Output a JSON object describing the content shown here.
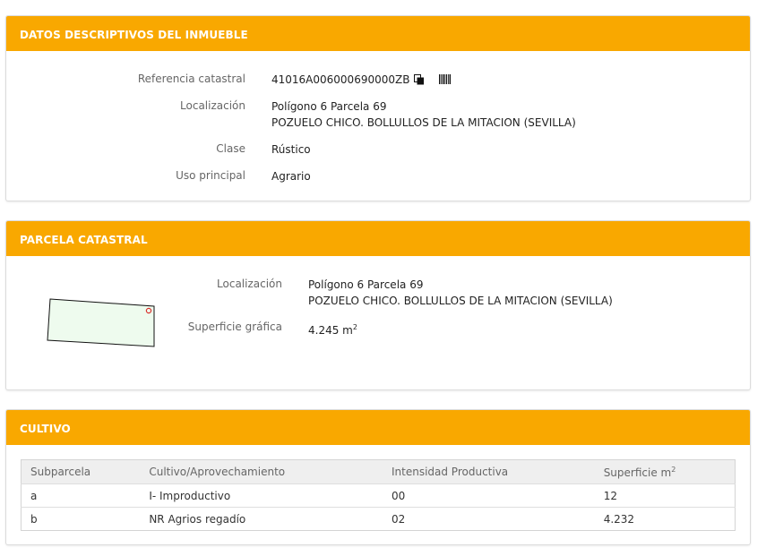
{
  "inmueble": {
    "title": "DATOS DESCRIPTIVOS DEL INMUEBLE",
    "referencia_label": "Referencia catastral",
    "referencia_value": "41016A006000690000ZB",
    "localizacion_label": "Localización",
    "localizacion_line1": "Polígono 6 Parcela 69",
    "localizacion_line2": "POZUELO CHICO. BOLLULLOS DE LA MITACION (SEVILLA)",
    "clase_label": "Clase",
    "clase_value": "Rústico",
    "uso_label": "Uso principal",
    "uso_value": "Agrario",
    "icons": [
      "copy-icon",
      "barcode-icon"
    ]
  },
  "parcela": {
    "title": "PARCELA CATASTRAL",
    "localizacion_label": "Localización",
    "localizacion_line1": "Polígono 6 Parcela 69",
    "localizacion_line2": "POZUELO CHICO. BOLLULLOS DE LA MITACION (SEVILLA)",
    "superficie_label": "Superficie gráfica",
    "superficie_value": "4.245 m",
    "superficie_unit_exp": "2",
    "map_fill": "#eefbee",
    "marker_color": "#d9302c"
  },
  "cultivo": {
    "title": "CULTIVO",
    "headers": [
      "Subparcela",
      "Cultivo/Aprovechamiento",
      "Intensidad Productiva",
      "Superficie m"
    ],
    "header_exp": "2",
    "rows": [
      [
        "a",
        "I- Improductivo",
        "00",
        "12"
      ],
      [
        "b",
        "NR Agrios regadío",
        "02",
        "4.232"
      ]
    ]
  },
  "colors": {
    "header_bg": "#f9a800",
    "label_text": "#666666"
  }
}
